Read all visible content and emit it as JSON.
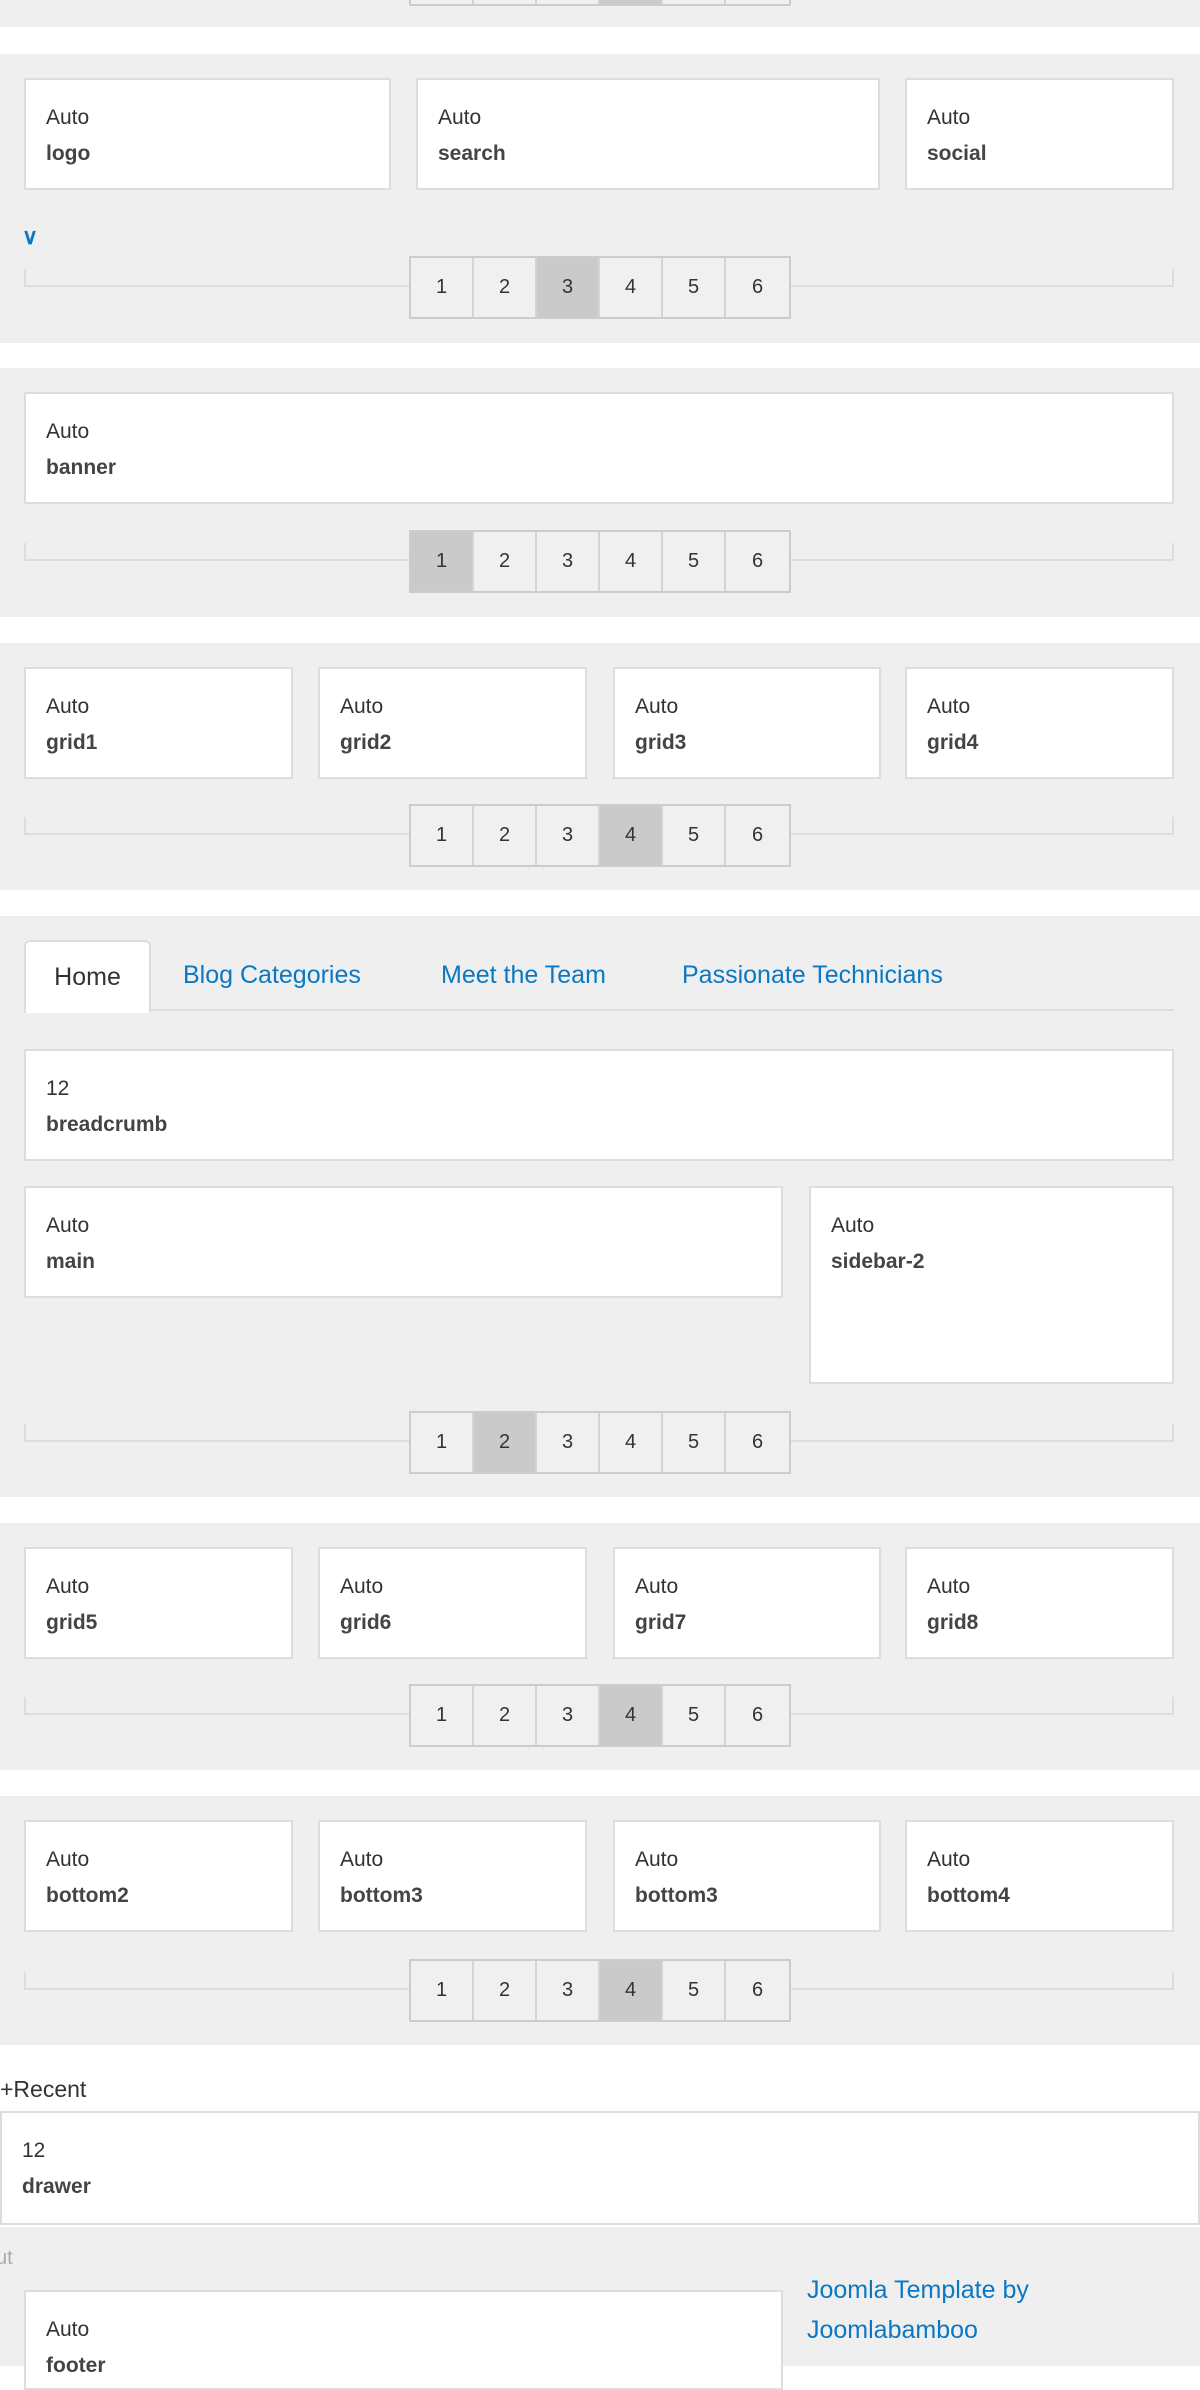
{
  "pagination": {
    "pages": [
      "1",
      "2",
      "3",
      "4",
      "5",
      "6"
    ]
  },
  "sections": [
    {
      "active_page": "4",
      "modules": []
    },
    {
      "active_page": "3",
      "modules": [
        {
          "width": "Auto",
          "name": "logo"
        },
        {
          "width": "Auto",
          "name": "search"
        },
        {
          "width": "Auto",
          "name": "social"
        }
      ],
      "collapse_icon": "chevron-down-icon"
    },
    {
      "active_page": "1",
      "modules": [
        {
          "width": "Auto",
          "name": "banner"
        }
      ]
    },
    {
      "active_page": "4",
      "modules": [
        {
          "width": "Auto",
          "name": "grid1"
        },
        {
          "width": "Auto",
          "name": "grid2"
        },
        {
          "width": "Auto",
          "name": "grid3"
        },
        {
          "width": "Auto",
          "name": "grid4"
        }
      ]
    },
    {
      "active_page": "2",
      "tabs": [
        "Home",
        "Blog Categories",
        "Meet the Team",
        "Passionate Technicians"
      ],
      "active_tab": "Home",
      "modules": [
        {
          "width": "12",
          "name": "breadcrumb"
        },
        {
          "width": "Auto",
          "name": "main"
        },
        {
          "width": "Auto",
          "name": "sidebar-2"
        }
      ]
    },
    {
      "active_page": "4",
      "modules": [
        {
          "width": "Auto",
          "name": "grid5"
        },
        {
          "width": "Auto",
          "name": "grid6"
        },
        {
          "width": "Auto",
          "name": "grid7"
        },
        {
          "width": "Auto",
          "name": "grid8"
        }
      ]
    },
    {
      "active_page": "4",
      "modules": [
        {
          "width": "Auto",
          "name": "bottom2"
        },
        {
          "width": "Auto",
          "name": "bottom3"
        },
        {
          "width": "Auto",
          "name": "bottom3"
        },
        {
          "width": "Auto",
          "name": "bottom4"
        }
      ]
    }
  ],
  "recent": {
    "label": "+Recent",
    "module": {
      "width": "12",
      "name": "drawer"
    }
  },
  "footer_section": {
    "label_fragment": "ut",
    "module": {
      "width": "Auto",
      "name": "footer"
    },
    "links": [
      "Joomla Template by",
      "Joomlabamboo"
    ]
  },
  "colors": {
    "accent": "#0a78c2",
    "panel": "#efefef",
    "active_page": "#cacaca"
  }
}
